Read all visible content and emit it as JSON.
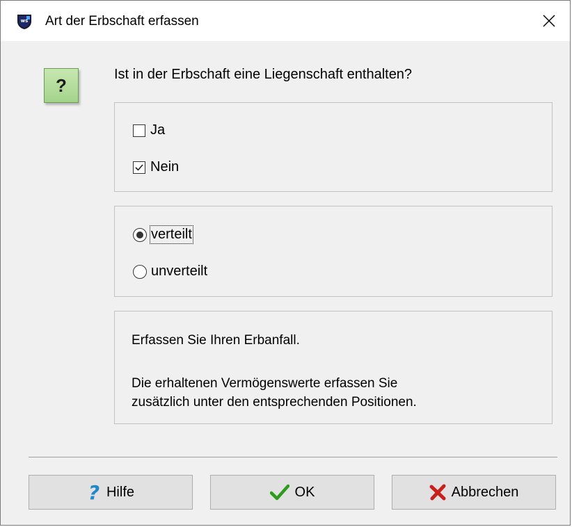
{
  "window": {
    "title": "Art der Erbschaft erfassen"
  },
  "question": {
    "icon_symbol": "?",
    "text": "Ist in der Erbschaft eine Liegenschaft enthalten?"
  },
  "property_options": [
    {
      "label": "Ja",
      "checked": false
    },
    {
      "label": "Nein",
      "checked": true
    }
  ],
  "distribution_options": [
    {
      "label": "verteilt",
      "selected": true
    },
    {
      "label": "unverteilt",
      "selected": false
    }
  ],
  "info": {
    "line1": "Erfassen Sie Ihren Erbanfall.",
    "line2": "Die erhaltenen Vermögenswerte erfassen Sie",
    "line3": "zusätzlich unter den entsprechenden Positionen."
  },
  "buttons": {
    "help": "Hilfe",
    "ok": "OK",
    "cancel": "Abbrechen"
  },
  "colors": {
    "help_icon": "#1e88c8",
    "ok_icon": "#2e9a1e",
    "cancel_icon": "#c8201a",
    "question_icon_bg": "#b5dd9d"
  }
}
